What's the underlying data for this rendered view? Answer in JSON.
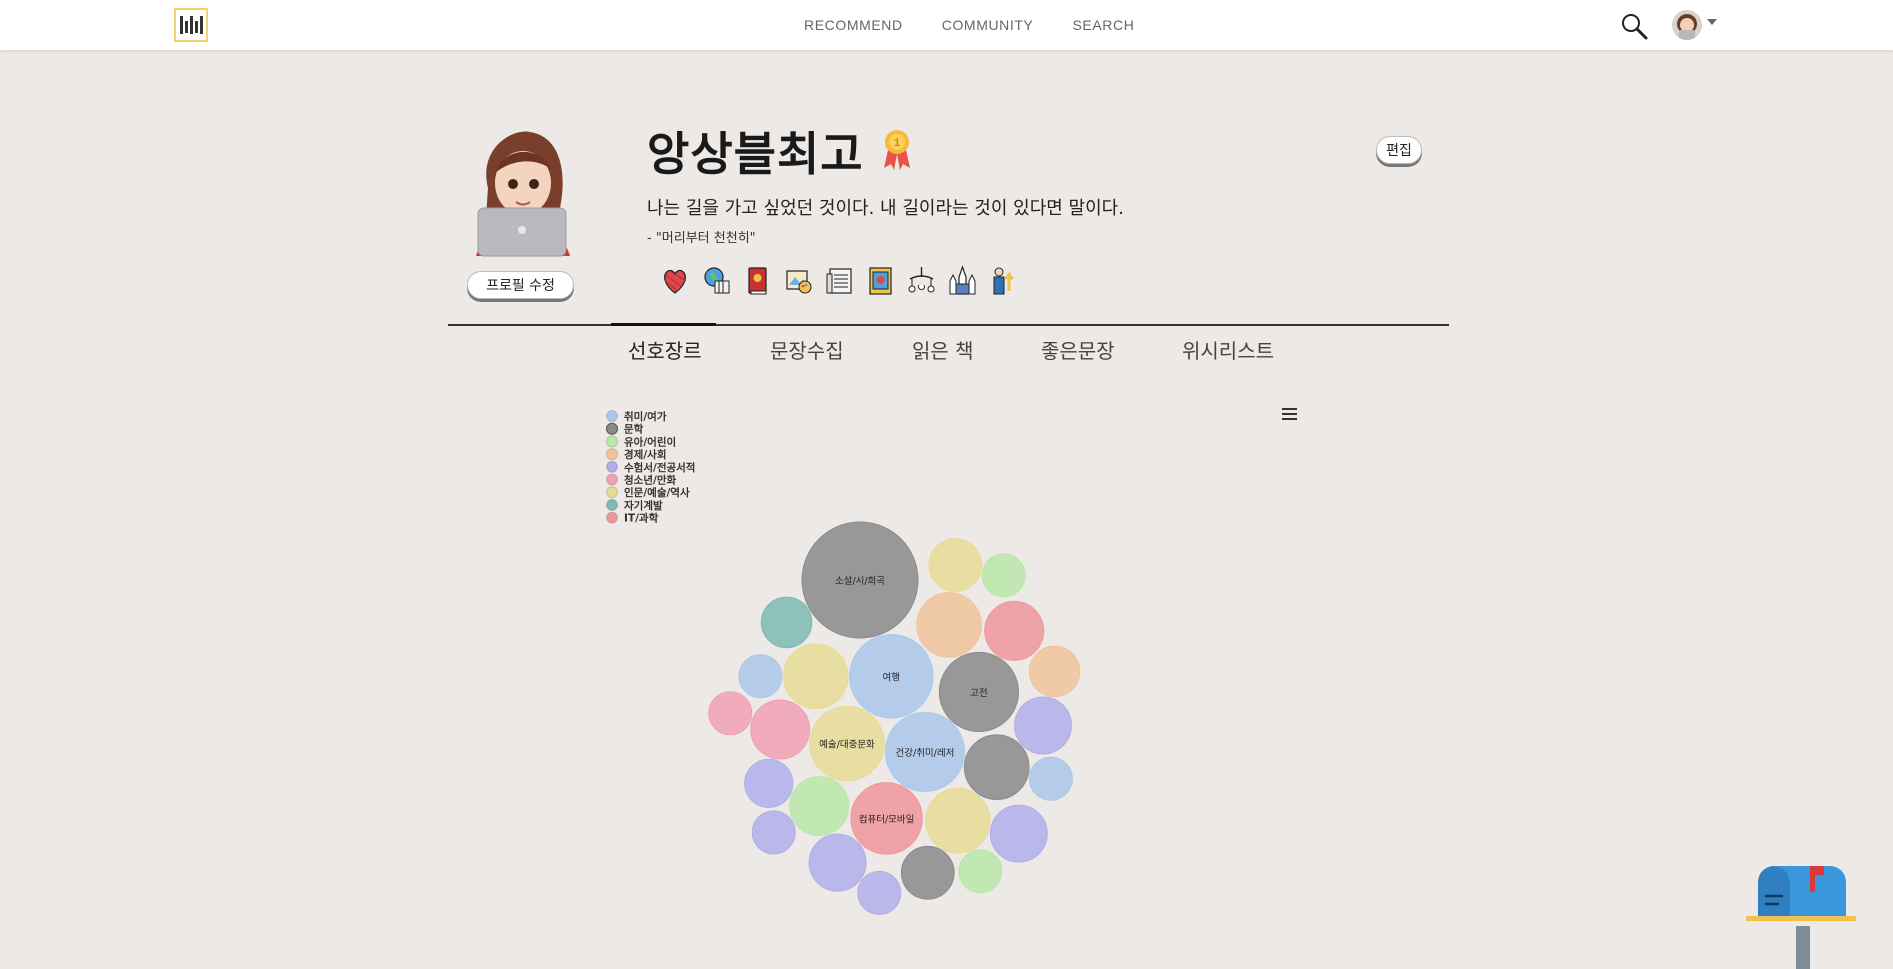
{
  "nav": {
    "links": [
      "RECOMMEND",
      "COMMUNITY",
      "SEARCH"
    ]
  },
  "profile": {
    "username": "앙상블최고",
    "quote": "나는 길을 가고 싶었던 것이다. 내 길이라는 것이 있다면 말이다.",
    "quote_source": "- \"머리부터 천천히\"",
    "edit_profile_label": "프로필 수정",
    "edit_label": "편집",
    "badges": [
      "yarn-heart-icon",
      "globe-books-icon",
      "red-book-icon",
      "painting-palette-icon",
      "newspaper-icon",
      "comic-book-icon",
      "baby-mobile-icon",
      "cathedral-icon",
      "businessman-icon"
    ]
  },
  "tabs": [
    "선호장르",
    "문장수집",
    "읽은 책",
    "좋은문장",
    "위시리스트"
  ],
  "colors": {
    "accent": "#f3d36b",
    "text": "#222222",
    "background": "#ede9e6"
  },
  "chart_data": {
    "type": "packed-bubble",
    "legend_position": "top-left",
    "series": [
      {
        "name": "취미/여가",
        "color": "#a9c7ea",
        "points": [
          {
            "label": "여행",
            "value": 30
          },
          {
            "label": "건강/취미/레저",
            "value": 27
          },
          {
            "label": "",
            "value": 8
          },
          {
            "label": "",
            "value": 8
          }
        ]
      },
      {
        "name": "문학",
        "color": "#8a8a8a",
        "points": [
          {
            "label": "소설/시/희곡",
            "value": 58
          },
          {
            "label": "고전",
            "value": 27
          },
          {
            "label": "",
            "value": 18
          },
          {
            "label": "",
            "value": 12
          }
        ]
      },
      {
        "name": "유아/어린이",
        "color": "#b9e8a8",
        "points": [
          {
            "label": "",
            "value": 15
          },
          {
            "label": "",
            "value": 8
          },
          {
            "label": "",
            "value": 8
          }
        ]
      },
      {
        "name": "경제/사회",
        "color": "#f0c39a",
        "points": [
          {
            "label": "",
            "value": 18
          },
          {
            "label": "",
            "value": 11
          }
        ]
      },
      {
        "name": "수험서/전공서적",
        "color": "#b0aeea",
        "points": [
          {
            "label": "",
            "value": 14
          },
          {
            "label": "",
            "value": 14
          },
          {
            "label": "",
            "value": 14
          },
          {
            "label": "",
            "value": 10
          },
          {
            "label": "",
            "value": 8
          },
          {
            "label": "",
            "value": 8
          }
        ]
      },
      {
        "name": "청소년/만화",
        "color": "#f0a0b4",
        "points": [
          {
            "label": "",
            "value": 15
          },
          {
            "label": "",
            "value": 8
          }
        ]
      },
      {
        "name": "인문/예술/역사",
        "color": "#e6dc94",
        "points": [
          {
            "label": "예술/대중문화",
            "value": 24
          },
          {
            "label": "",
            "value": 18
          },
          {
            "label": "",
            "value": 18
          },
          {
            "label": "",
            "value": 12
          }
        ]
      },
      {
        "name": "자기계발",
        "color": "#7dbab2",
        "points": [
          {
            "label": "",
            "value": 11
          }
        ]
      },
      {
        "name": "IT/과학",
        "color": "#f0979a",
        "points": [
          {
            "label": "컴퓨터/모바일",
            "value": 22
          },
          {
            "label": "",
            "value": 15
          }
        ]
      }
    ]
  }
}
